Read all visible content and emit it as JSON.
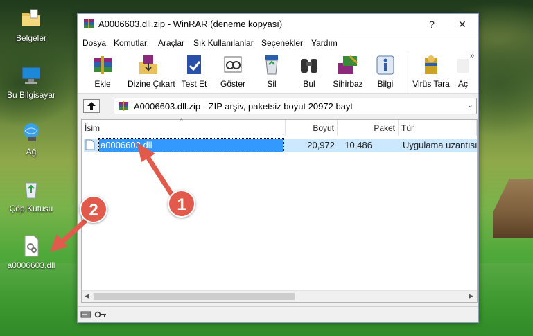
{
  "desktop": {
    "icons": [
      {
        "label": "Belgeler",
        "icon": "folder-icon"
      },
      {
        "label": "Bu Bilgisayar",
        "icon": "computer-icon"
      },
      {
        "label": "Ağ",
        "icon": "network-icon"
      },
      {
        "label": "Çöp Kutusu",
        "icon": "recycle-bin-icon"
      },
      {
        "label": "a0006603.dll",
        "icon": "dll-file-icon"
      }
    ]
  },
  "window": {
    "title": "A0006603.dll.zip - WinRAR (deneme kopyası)",
    "help_label": "?",
    "close_label": "✕",
    "menu": [
      "Dosya",
      "Komutlar",
      "Araçlar",
      "Sık Kullanılanlar",
      "Seçenekler",
      "Yardım"
    ],
    "toolbar": [
      {
        "label": "Ekle",
        "icon": "add-archive-icon"
      },
      {
        "label": "Dizine Çıkart",
        "icon": "extract-icon"
      },
      {
        "label": "Test Et",
        "icon": "test-icon"
      },
      {
        "label": "Göster",
        "icon": "view-icon"
      },
      {
        "label": "Sil",
        "icon": "delete-icon"
      },
      {
        "label": "Bul",
        "icon": "find-icon"
      },
      {
        "label": "Sihirbaz",
        "icon": "wizard-icon"
      },
      {
        "label": "Bilgi",
        "icon": "info-icon"
      },
      {
        "label": "Virüs Tara",
        "icon": "virus-scan-icon"
      },
      {
        "label": "Aç",
        "icon": "open-icon"
      }
    ],
    "toolbar_more": "»",
    "address": "A0006603.dll.zip - ZIP arşiv, paketsiz boyut 20972 bayt",
    "columns": {
      "name": "İsim",
      "size": "Boyut",
      "packed": "Paket",
      "type": "Tür"
    },
    "files": [
      {
        "name": "a0006603.dll",
        "size": "20,972",
        "packed": "10,486",
        "type": "Uygulama uzantısı"
      }
    ]
  },
  "annotations": {
    "badge_1": "1",
    "badge_2": "2"
  },
  "colors": {
    "selection": "#3399ff",
    "row_highlight": "#cce8ff",
    "badge": "#e25a4b"
  }
}
